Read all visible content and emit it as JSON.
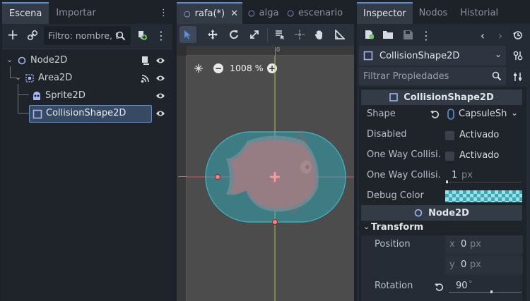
{
  "scene_dock": {
    "tabs": [
      "Escena",
      "Importar"
    ],
    "filter_placeholder": "Filtro: nombre, t",
    "nodes": [
      {
        "label": "Node2D",
        "icon": "circle-icon",
        "color": "#a5b7f3"
      },
      {
        "label": "Area2D",
        "icon": "area-icon",
        "color": "#a5b7f3"
      },
      {
        "label": "Sprite2D",
        "icon": "sprite-icon",
        "color": "#a5b7f3"
      },
      {
        "label": "CollisionShape2D",
        "icon": "collision-icon",
        "color": "#a5b7f3"
      }
    ]
  },
  "editor": {
    "tabs": [
      "rafa(*)",
      "alga",
      "escenario"
    ],
    "zoom_label": "1008 %",
    "ruler_zero": "0"
  },
  "inspector": {
    "tabs": [
      "Inspector",
      "Nodos",
      "Historial"
    ],
    "object_name": "CollisionShape2D",
    "filter_placeholder": "Filtrar Propiedades",
    "section_title": "CollisionShape2D",
    "properties": [
      {
        "label": "Shape",
        "value": "CapsuleSh"
      },
      {
        "label": "Disabled",
        "value": "Activado"
      },
      {
        "label": "One Way Collisi...",
        "value": "Activado"
      },
      {
        "label": "One Way Collisi...",
        "value": "1",
        "unit": "px"
      },
      {
        "label": "Debug Color",
        "value": ""
      }
    ],
    "node2d_section": "Node2D",
    "transform_label": "Transform",
    "position_label": "Position",
    "position_x": "0",
    "position_y": "0",
    "axis_x": "x",
    "axis_y": "y",
    "unit_px": "px",
    "rotation_label": "Rotation",
    "rotation_value": "90",
    "rotation_unit": "°",
    "accent": "#5b8fd8"
  }
}
